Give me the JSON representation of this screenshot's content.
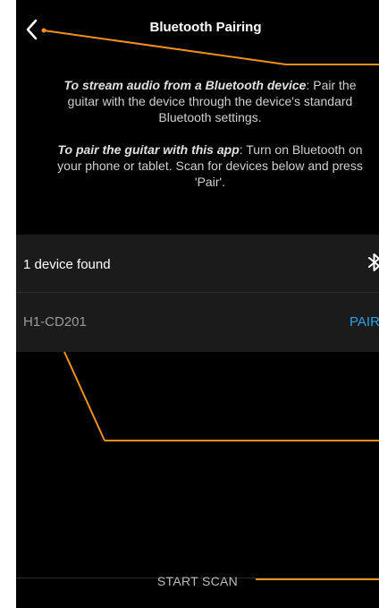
{
  "header": {
    "title": "Bluetooth Pairing"
  },
  "intro": {
    "para1_emphasis": "To stream audio from a Bluetooth device",
    "para1_rest": ": Pair the guitar with the device through the device's standard Bluetooth settings.",
    "para2_emphasis": "To pair the guitar with this app",
    "para2_rest": ": Turn on Bluetooth on your phone or tablet. Scan for devices below and press 'Pair'."
  },
  "devices": {
    "found_label": "1 device found",
    "items": [
      {
        "name": "H1-CD201",
        "action": "PAIR"
      }
    ]
  },
  "footer": {
    "scan_label": "START SCAN"
  },
  "colors": {
    "background": "#000000",
    "row": "#1b1b1b",
    "accent": "#2aa2e8",
    "callout": "#f0901e"
  },
  "icons": {
    "back": "chevron-left-icon",
    "bluetooth": "bluetooth-icon"
  }
}
